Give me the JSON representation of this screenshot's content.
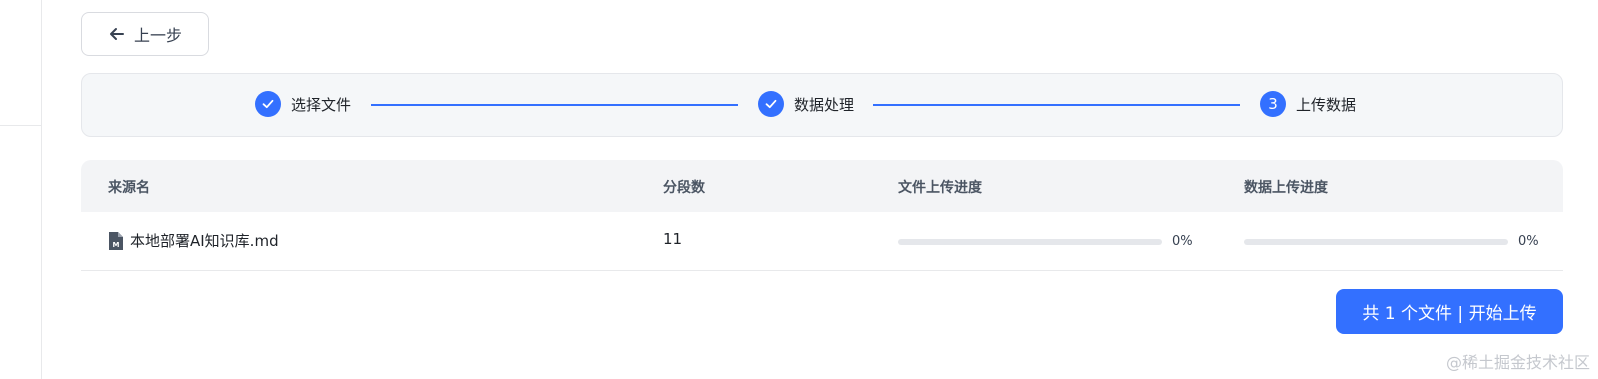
{
  "toolbar": {
    "back_label": "上一步"
  },
  "steps": [
    {
      "label": "选择文件",
      "state": "done"
    },
    {
      "label": "数据处理",
      "state": "done"
    },
    {
      "label": "上传数据",
      "state": "current",
      "number": "3"
    }
  ],
  "table": {
    "headers": [
      "来源名",
      "分段数",
      "文件上传进度",
      "数据上传进度"
    ],
    "rows": [
      {
        "name": "本地部署AI知识库.md",
        "segments": "11",
        "file_progress": 0,
        "file_progress_label": "0%",
        "data_progress": 0,
        "data_progress_label": "0%"
      }
    ]
  },
  "upload_button": {
    "label": "共 1 个文件 | 开始上传"
  },
  "watermark": "@稀土掘金技术社区",
  "colors": {
    "accent": "#3370ff",
    "track": "#e5e7eb",
    "header_bg": "#f3f4f6",
    "steps_bg": "#f5f7f9"
  },
  "icons": {
    "back": "arrow-left-icon",
    "done": "check-icon",
    "file": "markdown-file-icon"
  }
}
